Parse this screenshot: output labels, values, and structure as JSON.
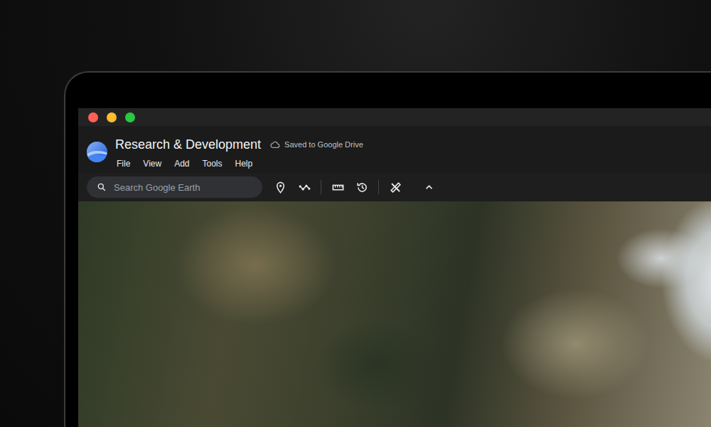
{
  "window": {
    "title": "Research & Development",
    "status": "Saved to Google Drive"
  },
  "menu": [
    "File",
    "View",
    "Add",
    "Tools",
    "Help"
  ],
  "search": {
    "placeholder": "Search Google Earth"
  }
}
